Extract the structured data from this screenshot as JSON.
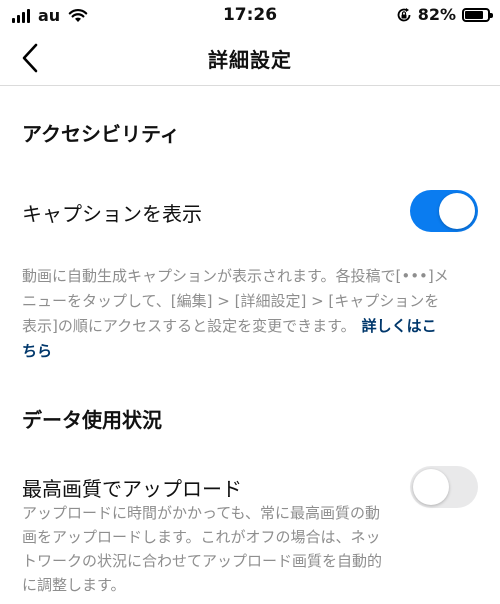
{
  "status_bar": {
    "carrier": "au",
    "time": "17:26",
    "battery_percent": "82%",
    "battery_level": 0.82
  },
  "nav": {
    "title": "詳細設定"
  },
  "accessibility": {
    "title": "アクセシビリティ",
    "captions_label": "キャプションを表示",
    "captions_on": true,
    "desc_line1": "動画に自動生成キャプションが表示されます。各投稿で[•••]メ",
    "desc_line2": "ニューをタップして、[編集] > [詳細設定] > [キャプションを",
    "desc_line3": "表示]の順にアクセスすると設定を変更できます。",
    "learn_more_a": "詳しくはこ",
    "learn_more_b": "ちら"
  },
  "data_usage": {
    "title": "データ使用状況",
    "hq_upload_label": "最高画質でアップロード",
    "hq_upload_on": false,
    "desc_line1": "アップロードに時間がかかっても、常に最高画質の動",
    "desc_line2": "画をアップロードします。これがオフの場合は、ネッ",
    "desc_line3": "トワークの状況に合わせてアップロード画質を自動的",
    "desc_line4": "に調整します。"
  },
  "icons": {
    "back": "chevron-left-icon",
    "wifi": "wifi-icon",
    "signal": "signal-icon",
    "orientation_lock": "orientation-lock-icon",
    "battery": "battery-icon"
  },
  "colors": {
    "toggle_on": "#0a7cf0",
    "toggle_off": "#e9e9ea",
    "link": "#00376b",
    "secondary_text": "#8e8e8e"
  }
}
